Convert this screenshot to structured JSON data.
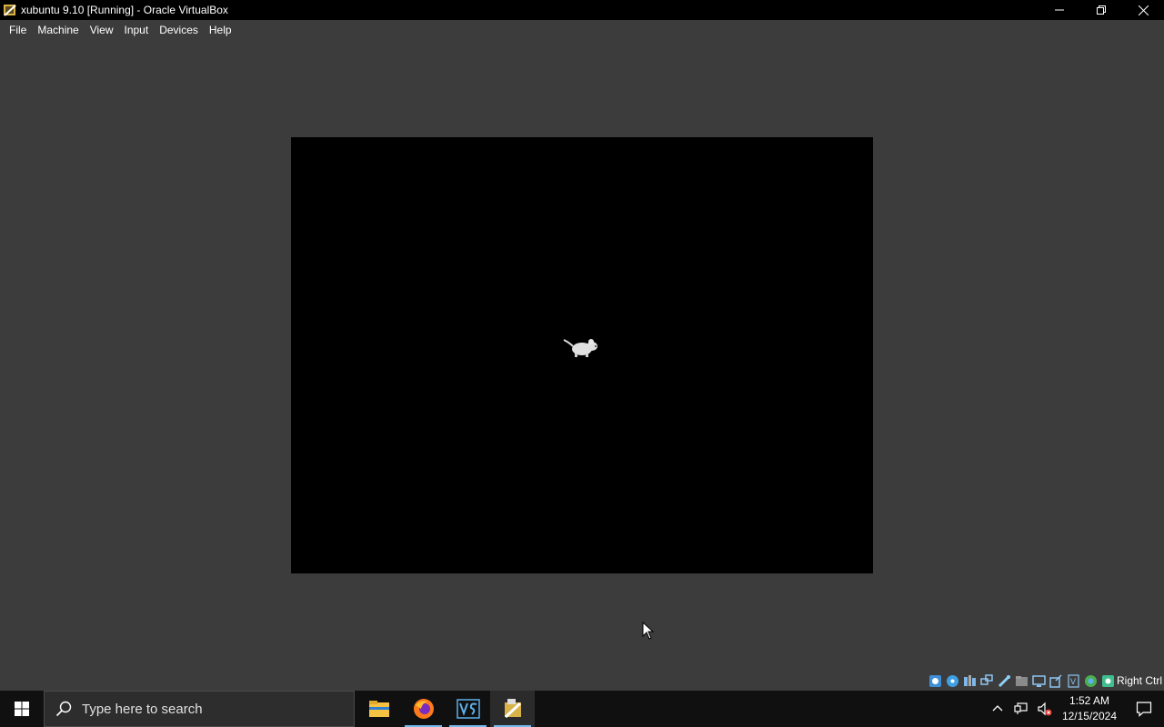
{
  "window": {
    "title": "xubuntu 9.10 [Running] - Oracle VirtualBox"
  },
  "menu": {
    "items": [
      "File",
      "Machine",
      "View",
      "Input",
      "Devices",
      "Help"
    ]
  },
  "status_bar": {
    "host_key": "Right Ctrl"
  },
  "taskbar": {
    "search_placeholder": "Type here to search",
    "time": "1:52 AM",
    "date": "12/15/2024"
  },
  "colors": {
    "background": "#3c3c3c",
    "accent": "#76b9ed"
  }
}
